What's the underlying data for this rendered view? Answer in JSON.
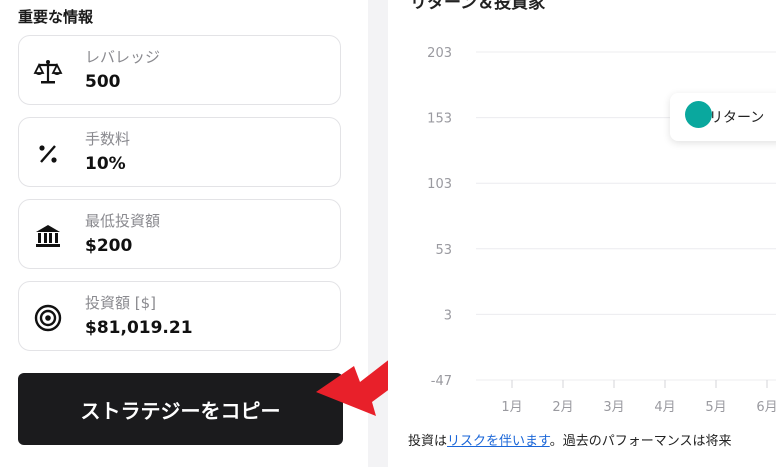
{
  "info": {
    "title": "重要な情報",
    "cards": [
      {
        "icon": "scale-icon",
        "label": "レバレッジ",
        "value": "500"
      },
      {
        "icon": "percent-icon",
        "label": "手数料",
        "value": "10%"
      },
      {
        "icon": "bank-icon",
        "label": "最低投資額",
        "value": "$200"
      },
      {
        "icon": "target-icon",
        "label": "投資額 [$]",
        "value": "$81,019.21"
      }
    ],
    "copy_button": "ストラテジーをコピー"
  },
  "chart": {
    "title_fragment": "リターン＆投資家",
    "legend_label": "リターン",
    "accent": "#0aa89e"
  },
  "chart_data": {
    "type": "line",
    "categories": [
      "1月",
      "2月",
      "3月",
      "4月",
      "5月",
      "6月"
    ],
    "ylim": [
      -47,
      203
    ],
    "yticks": [
      -47,
      3,
      53,
      103,
      153,
      203
    ],
    "grid": true,
    "legend_placement": "top-right",
    "series": [
      {
        "name": "リターン",
        "values": []
      }
    ]
  },
  "disclaimer": {
    "prefix": "投資は",
    "link": "リスクを伴います",
    "suffix": "。過去のパフォーマンスは将来"
  }
}
